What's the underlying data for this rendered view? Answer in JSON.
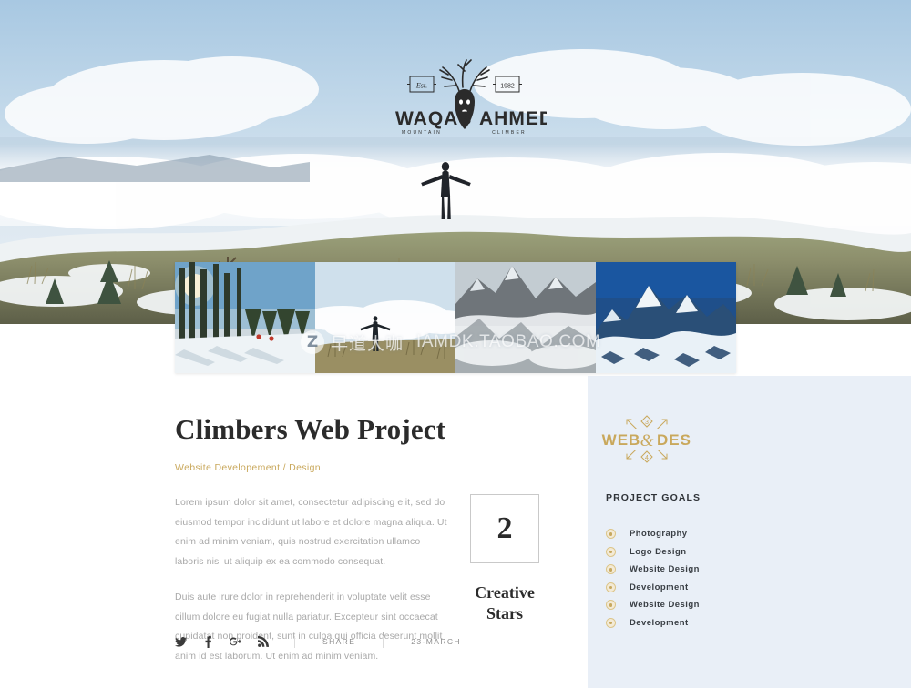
{
  "hero": {
    "alt": "mountain-ridge-climber-panorama",
    "figure_alt": "silhouette-climber-arms-outstretched",
    "logo": {
      "name_left": "WAQAS",
      "name_right": "AHMED",
      "tagline_left": "MOUNTAIN",
      "tagline_right": "CLIMBER",
      "badge_left": "Est.",
      "badge_right": "1982",
      "emblem": "deer-head-antlers"
    }
  },
  "gallery": {
    "thumbnails": [
      {
        "alt": "snowy-forest-trail-with-skiers"
      },
      {
        "alt": "climber-on-ridge-above-clouds"
      },
      {
        "alt": "rocky-peaks-in-fog"
      },
      {
        "alt": "snow-capped-mountain-blue-sky"
      }
    ],
    "watermark": {
      "badge": "Z",
      "brand_cn": "早道大咖",
      "url": "IAMDK.TAOBAO.COM"
    }
  },
  "main": {
    "title": "Climbers Web Project",
    "subtitle": "Website Developement / Design",
    "paragraph_1": "Lorem ipsum dolor sit amet, consectetur adipiscing elit, sed do eiusmod tempor incididunt ut labore et dolore magna aliqua. Ut enim ad minim veniam, quis nostrud exercitation ullamco laboris nisi ut aliquip ex ea commodo consequat.",
    "paragraph_2": "Duis aute irure dolor in reprehenderit in voluptate velit esse cillum dolore eu fugiat nulla pariatur. Excepteur sint occaecat cupidatat non proident, sunt in culpa qui officia deserunt mollit anim id est laborum. Ut enim ad minim veniam."
  },
  "stat": {
    "number": "2",
    "label_line_1": "Creative",
    "label_line_2": "Stars"
  },
  "meta": {
    "social": [
      {
        "name": "twitter-icon",
        "label": "Twitter"
      },
      {
        "name": "facebook-icon",
        "label": "Facebook"
      },
      {
        "name": "google-plus-icon",
        "label": "Google Plus"
      },
      {
        "name": "rss-icon",
        "label": "RSS"
      }
    ],
    "share_label": "SHARE",
    "date": "23-MARCH"
  },
  "sidebar": {
    "badge": {
      "text_left": "WEB",
      "ampersand": "&",
      "text_right": "DES",
      "number_top": "3",
      "number_bottom": "4"
    },
    "goals_title": "PROJECT GOALS",
    "goals": [
      {
        "label": "Photography"
      },
      {
        "label": "Logo Design"
      },
      {
        "label": "Website Design"
      },
      {
        "label": "Development"
      },
      {
        "label": "Website Design"
      },
      {
        "label": "Development"
      }
    ]
  },
  "colors": {
    "gold": "#c9a85c",
    "panel_blue": "#e9eff7",
    "ink": "#2b2b2b",
    "muted": "#a9a9a9"
  }
}
